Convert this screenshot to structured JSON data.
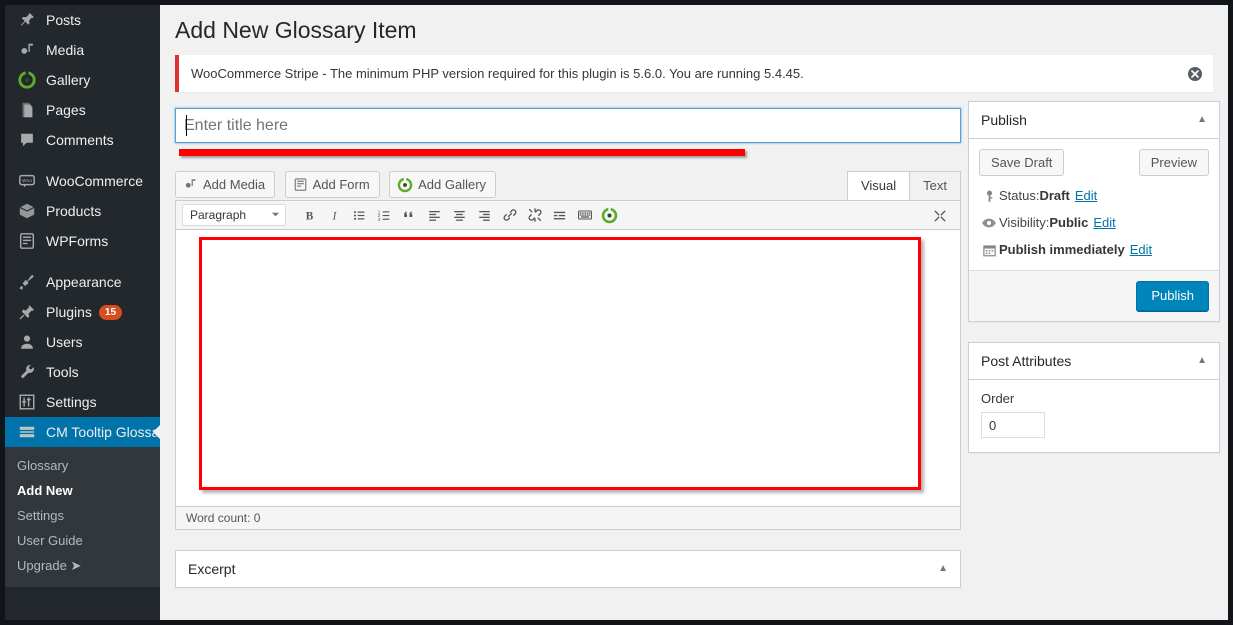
{
  "sidebar": {
    "groups": [
      {
        "items": [
          {
            "label": "Posts",
            "icon": "pin-icon",
            "name": "posts"
          },
          {
            "label": "Media",
            "icon": "media-icon",
            "name": "media"
          },
          {
            "label": "Gallery",
            "icon": "gallery-icon",
            "name": "gallery"
          },
          {
            "label": "Pages",
            "icon": "pages-icon",
            "name": "pages"
          },
          {
            "label": "Comments",
            "icon": "comments-icon",
            "name": "comments"
          }
        ]
      },
      {
        "items": [
          {
            "label": "WooCommerce",
            "icon": "woocommerce-icon",
            "name": "woocommerce"
          },
          {
            "label": "Products",
            "icon": "products-icon",
            "name": "products"
          },
          {
            "label": "WPForms",
            "icon": "wpforms-icon",
            "name": "wpforms"
          }
        ]
      },
      {
        "items": [
          {
            "label": "Appearance",
            "icon": "brush-icon",
            "name": "appearance"
          },
          {
            "label": "Plugins",
            "icon": "plugins-icon",
            "name": "plugins",
            "badge": "15"
          },
          {
            "label": "Users",
            "icon": "users-icon",
            "name": "users"
          },
          {
            "label": "Tools",
            "icon": "tools-icon",
            "name": "tools"
          },
          {
            "label": "Settings",
            "icon": "settings-icon",
            "name": "settings"
          },
          {
            "label": "CM Tooltip Glossary",
            "icon": "glossary-icon",
            "name": "cm-tooltip-glossary",
            "active": true
          }
        ]
      }
    ],
    "submenu": [
      {
        "label": "Glossary",
        "name": "glossary"
      },
      {
        "label": "Add New",
        "name": "add-new",
        "current": true
      },
      {
        "label": "Settings",
        "name": "settings"
      },
      {
        "label": "User Guide",
        "name": "user-guide"
      },
      {
        "label": "Upgrade ➤",
        "name": "upgrade"
      }
    ]
  },
  "page": {
    "title": "Add New Glossary Item"
  },
  "notice": {
    "text": "WooCommerce Stripe - The minimum PHP version required for this plugin is 5.6.0. You are running 5.4.45.",
    "dismiss_label": "dismiss-notice",
    "accent_color": "#dc3232"
  },
  "title_field": {
    "value": "",
    "placeholder": "Enter title here"
  },
  "editor": {
    "media_buttons": [
      {
        "label": "Add Media",
        "icon": "add-media-icon",
        "name": "add-media"
      },
      {
        "label": "Add Form",
        "icon": "add-form-icon",
        "name": "add-form"
      },
      {
        "label": "Add Gallery",
        "icon": "add-gallery-icon",
        "name": "add-gallery"
      }
    ],
    "mode_tabs": [
      {
        "label": "Visual",
        "name": "visual",
        "active": true
      },
      {
        "label": "Text",
        "name": "text",
        "active": false
      }
    ],
    "format_select": {
      "value": "Paragraph"
    },
    "toolbar_icons": [
      "bold-icon",
      "italic-icon",
      "bulleted-list-icon",
      "numbered-list-icon",
      "blockquote-icon",
      "align-left-icon",
      "align-center-icon",
      "align-right-icon",
      "link-icon",
      "unlink-icon",
      "insert-more-icon",
      "toggle-toolbar-icon",
      "gallery-shortcode-icon"
    ],
    "fullscreen_icon": "fullscreen-icon",
    "body_text": "",
    "word_count": "Word count: 0"
  },
  "excerpt": {
    "title": "Excerpt",
    "toggle_icon": "chevron-up-icon"
  },
  "publish_box": {
    "title": "Publish",
    "toggle_icon": "chevron-up-icon",
    "save_draft": "Save Draft",
    "preview": "Preview",
    "rows": [
      {
        "icon": "key-icon",
        "prefix": "Status: ",
        "value": "Draft",
        "link": "Edit",
        "name": "status"
      },
      {
        "icon": "eye-icon",
        "prefix": "Visibility: ",
        "value": "Public",
        "link": "Edit",
        "name": "visibility"
      },
      {
        "icon": "calendar-icon",
        "prefix": "",
        "value": "Publish immediately",
        "link": "Edit",
        "name": "publish-date"
      }
    ],
    "publish_button": "Publish",
    "publish_color": "#0085ba"
  },
  "post_attributes": {
    "title": "Post Attributes",
    "toggle_icon": "chevron-up-icon",
    "order_label": "Order",
    "order_value": "0"
  },
  "annotations": {
    "color": "#ff0000",
    "title_underline": "title-field-highlight",
    "editor_box": "editor-area-highlight"
  }
}
